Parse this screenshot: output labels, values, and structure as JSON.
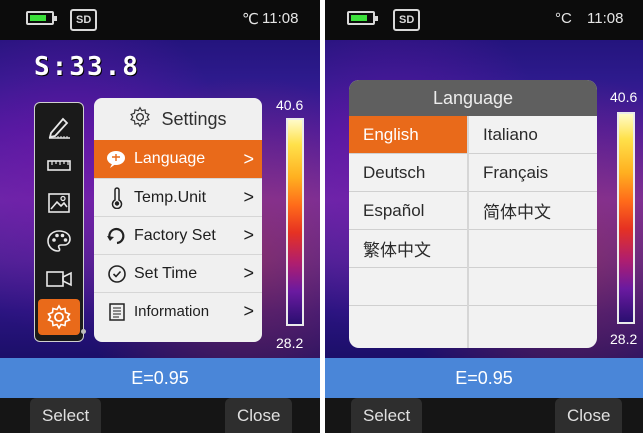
{
  "left_screen": {
    "status": {
      "sd": "SD",
      "unit": "℃",
      "time": "11:08"
    },
    "spot_temp": "S:33.8",
    "scale": {
      "max": "40.6",
      "min": "28.2"
    },
    "menu": {
      "title": "Settings",
      "items": [
        {
          "label": "Language",
          "icon": "language-icon",
          "active": true
        },
        {
          "label": "Temp.Unit",
          "icon": "thermometer-icon",
          "active": false
        },
        {
          "label": "Factory Set",
          "icon": "reset-icon",
          "active": false
        },
        {
          "label": "Set Time",
          "icon": "clock-icon",
          "active": false
        },
        {
          "label": "Information",
          "icon": "document-icon",
          "active": false
        }
      ],
      "chevron": ">"
    },
    "side_icons": [
      "edit-icon",
      "ruler-icon",
      "image-icon",
      "palette-icon",
      "video-icon",
      "settings-icon"
    ],
    "emissivity": "E=0.95",
    "softkeys": {
      "left": "Select",
      "right": "Close"
    }
  },
  "right_screen": {
    "status": {
      "sd": "SD",
      "unit": "°C",
      "time": "11:08"
    },
    "scale": {
      "max": "40.6",
      "min": "28.2"
    },
    "dialog": {
      "title": "Language",
      "languages": [
        "English",
        "Italiano",
        "Deutsch",
        "Français",
        "Español",
        "简体中文",
        "繁体中文"
      ],
      "selected": "English"
    },
    "emissivity": "E=0.95",
    "softkeys": {
      "left": "Select",
      "right": "Close"
    }
  },
  "colors": {
    "accent": "#e96a1a",
    "ebar": "#4a86d8",
    "battery": "#3be03b"
  }
}
